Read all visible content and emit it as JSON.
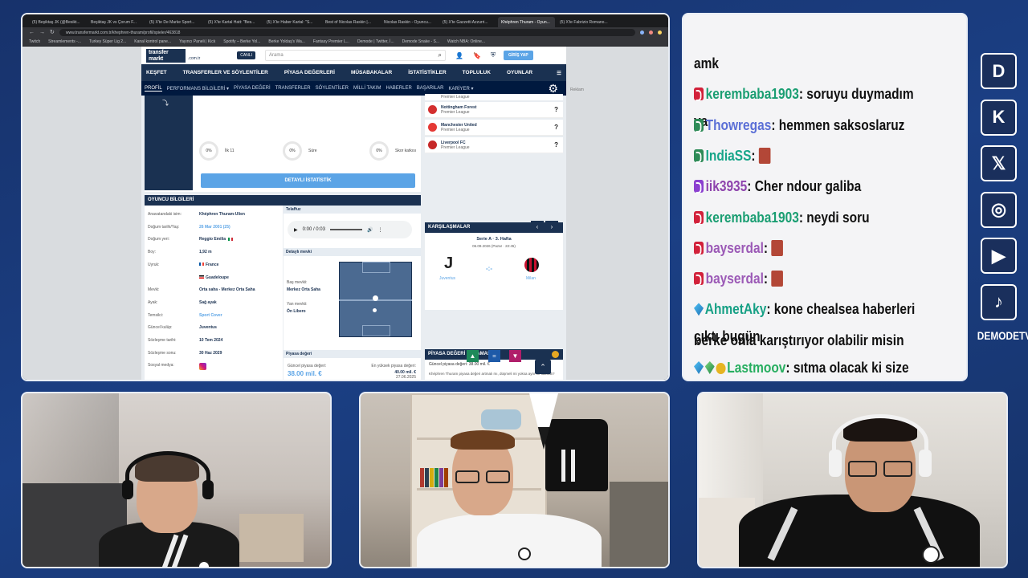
{
  "browser": {
    "tabs": [
      {
        "label": "(5) Beşiktaş JK (@Besikt...",
        "active": false
      },
      {
        "label": "Beşiktaş JK vs Çorum F...",
        "active": false
      },
      {
        "label": "(5) X'te De Marke Sport...",
        "active": false
      },
      {
        "label": "(5) X'te Kartal Hatt: \"Bes...",
        "active": false
      },
      {
        "label": "(5) X'te Haber Kartal: \"S...",
        "active": false
      },
      {
        "label": "Best of Nicolas Raskin |...",
        "active": false
      },
      {
        "label": "Nicolas Raskin - Oyuncu...",
        "active": false
      },
      {
        "label": "(5) X'te Gazzetti Azzurri...",
        "active": false
      },
      {
        "label": "Khéphren Thuram - Oyun...",
        "active": true
      },
      {
        "label": "(5) X'te Fabrizio Romano...",
        "active": false
      }
    ],
    "url": "www.transfermarkt.com.tr/khephren-thuram/profil/spieler/463818",
    "bookmarks": [
      "Twitch",
      "Streamlements -...",
      "Turkey Süper Lig 2...",
      "Kanal kontrol pane...",
      "Yayıncı Paneli | Kick",
      "Spotify – Berke Yol...",
      "Berke Yoldaş's Wa...",
      "Fantasy Premier L...",
      "Demode | Twitter, İ...",
      "Demode Snake - S...",
      "Watch NBA: Online..."
    ]
  },
  "site": {
    "logo_line1": "transfer",
    "logo_line2": "markt",
    "tld": ".com.tr",
    "live_label": "CANLI",
    "search_placeholder": "Arama",
    "login_label": "GİRİŞ YAP",
    "ads_label": "Reklam",
    "nav": [
      "KEŞFET",
      "TRANSFERLER VE SÖYLENTİLER",
      "PİYASA DEĞERLERİ",
      "MÜSABAKALAR",
      "İSTATİSTİKLER",
      "TOPLULUK",
      "OYUNLAR"
    ],
    "subnav": [
      "PROFİL",
      "PERFORMANS BİLGİLERİ ▾",
      "PİYASA DEĞERİ",
      "TRANSFERLER",
      "SÖYLENTİLER",
      "MİLLİ TAKIM",
      "HABERLER",
      "BAŞARILAR",
      "KARİYER ▾"
    ]
  },
  "stats": [
    {
      "value": "0%",
      "label": "İlk 11"
    },
    {
      "value": "0%",
      "label": "Süre"
    },
    {
      "value": "0%",
      "label": "Skor katkısı"
    }
  ],
  "detailed_stats_button": "DETAYLI İSTATİSTİK",
  "player_info": {
    "title": "OYUNCU BİLGİLERİ",
    "rows": [
      {
        "key": "Anavatandaki isim:",
        "value": "Khéphren Thuram-Ulien"
      },
      {
        "key": "Doğum tarihi/Yaş:",
        "value": "26 Mar 2001 (25)"
      },
      {
        "key": "Doğum yeri:",
        "value": "Reggio Emilia"
      },
      {
        "key": "Boy:",
        "value": "1,92 m"
      },
      {
        "key": "Uyruk:",
        "value": "France"
      },
      {
        "key": "",
        "value": "Guadeloupe"
      },
      {
        "key": "Mevki:",
        "value": "Orta saha - Merkez Orta Saha"
      },
      {
        "key": "Ayak:",
        "value": "Sağ ayak"
      },
      {
        "key": "Temsilci:",
        "value": "Sport Cover"
      },
      {
        "key": "Güncel kulüp:",
        "value": "Juventus"
      },
      {
        "key": "Sözleşme tarihi:",
        "value": "10 Tem 2024"
      },
      {
        "key": "Sözleşme sonu:",
        "value": "30 Haz 2029"
      },
      {
        "key": "Sosyal medya:",
        "value": ""
      }
    ]
  },
  "pronunciation": {
    "title": "Telaffuz",
    "time": "0:00 / 0:03"
  },
  "position": {
    "title": "Detaylı mevki",
    "main_label": "Baş mevkii:",
    "main_value": "Merkez Orta Saha",
    "side_label": "Yan mevkii:",
    "side_value": "Ön Libero"
  },
  "market_value": {
    "title": "Piyasa değeri",
    "current_label": "Güncel piyasa değeri:",
    "current_value": "38.00 mil. €",
    "max_label": "En yüksek piyasa değeri:",
    "max_value": "40.00 mil. €",
    "max_date": "27.06.2025"
  },
  "clubs": [
    {
      "name": "Nottingham Forest",
      "league": "Premier League",
      "q": "?",
      "color": "#d32f2f"
    },
    {
      "name": "Manchester United",
      "league": "Premier League",
      "q": "?",
      "color": "#e53935"
    },
    {
      "name": "Liverpool FC",
      "league": "Premier League",
      "q": "?",
      "color": "#c62828"
    }
  ],
  "clubs_top_partial": "Premier League",
  "matches": {
    "title": "KARŞILAŞMALAR",
    "league": "Serie A · 3. Hafta",
    "date": "06.09.2026 (Pazar · 22:45)",
    "home": "Juventus",
    "away": "Milan",
    "score": "-:-"
  },
  "vote": {
    "title": "PİYASA DEĞERİ OYLAMASI",
    "current": "Güncel piyasa değeri: 38.00 mil. €",
    "question": "Khéphren Thuram piyasa değeri artmalı mı, düşmeli mi yoksa aynı mı kalmalı?"
  },
  "chat": [
    {
      "user": "",
      "text": "amk",
      "badge": "",
      "color": "#111"
    },
    {
      "user": "kerembaba1903",
      "text": ": soruyu duymadım ya",
      "badge": "k",
      "color": "#1a9e72"
    },
    {
      "user": "Thowregas",
      "text": ": hemmen saksoslaruz",
      "badge": "g",
      "color": "#5b6fd6"
    },
    {
      "user": "IndiaSS",
      "text": ": ",
      "badge": "g",
      "color": "#17a589",
      "emote": true
    },
    {
      "user": "iik3935",
      "text": ": Cher ndour galiba",
      "badge": "p",
      "color": "#8e44ad"
    },
    {
      "user": "kerembaba1903",
      "text": ": neydi soru",
      "badge": "k",
      "color": "#1a9e72"
    },
    {
      "user": "bayserdal",
      "text": ": ",
      "badge": "k",
      "color": "#9b59b6",
      "emote": true
    },
    {
      "user": "bayserdal",
      "text": ": ",
      "badge": "k",
      "color": "#9b59b6",
      "emote": true
    },
    {
      "user": "AhmetAky",
      "text": ": kone chealsea haberleri çıktı bugün",
      "badge": "gem",
      "color": "#16a085"
    },
    {
      "user": "",
      "text": "berke onla karıştırıyor olabilir misin",
      "badge": "",
      "color": "#111"
    },
    {
      "user": "Lastmoov",
      "text": ": sıtma olacak ki size gelecek",
      "badge": "gem2",
      "color": "#27ae60"
    }
  ],
  "social": {
    "icons": [
      "demode-icon",
      "kick-icon",
      "x-icon",
      "instagram-icon",
      "youtube-icon",
      "tiktok-icon"
    ],
    "glyphs": [
      "D",
      "K",
      "𝕏",
      "◎",
      "▶",
      "♪"
    ],
    "brand": "DEMODETV"
  }
}
